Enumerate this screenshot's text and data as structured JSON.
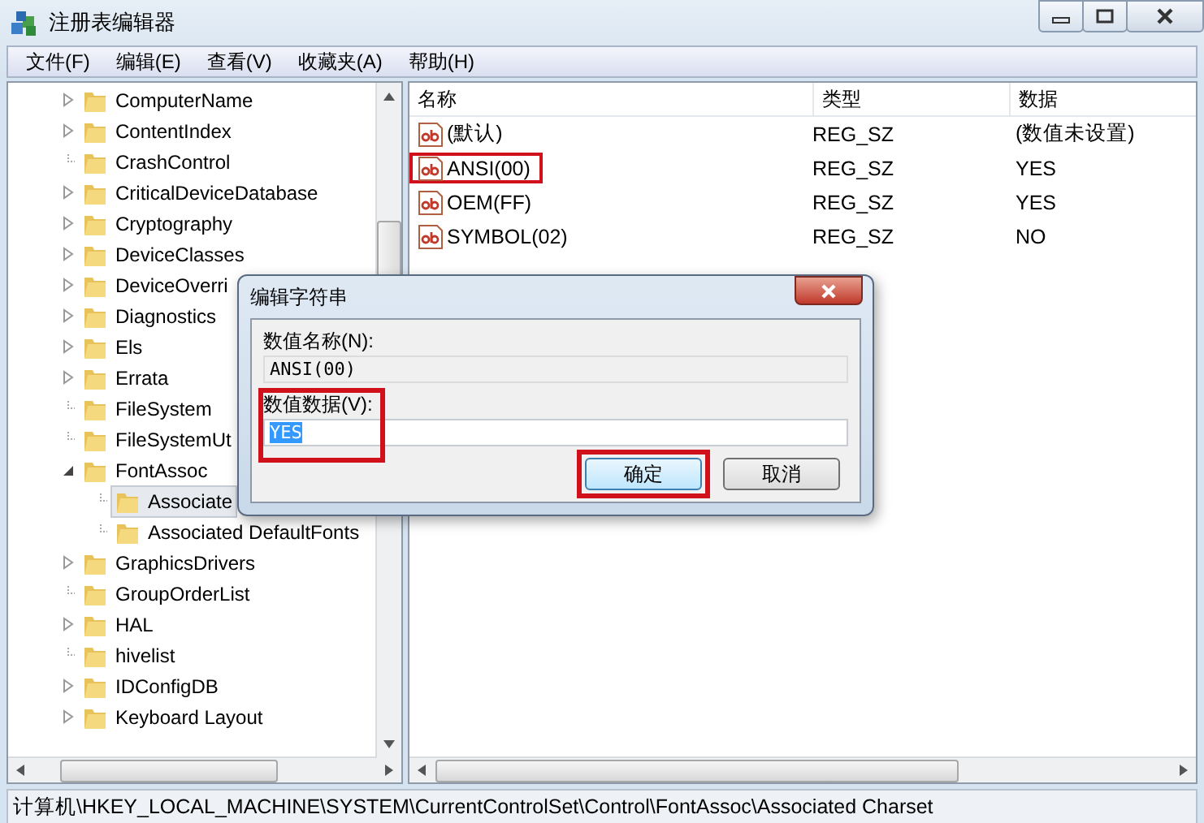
{
  "window": {
    "title": "注册表编辑器"
  },
  "menu": [
    "文件(F)",
    "编辑(E)",
    "查看(V)",
    "收藏夹(A)",
    "帮助(H)"
  ],
  "tree": {
    "items": [
      {
        "label": "ComputerName",
        "kind": "collapsed",
        "selected": false
      },
      {
        "label": "ContentIndex",
        "kind": "collapsed",
        "selected": false
      },
      {
        "label": "CrashControl",
        "kind": "leaf",
        "selected": false
      },
      {
        "label": "CriticalDeviceDatabase",
        "kind": "collapsed",
        "selected": false
      },
      {
        "label": "Cryptography",
        "kind": "collapsed",
        "selected": false
      },
      {
        "label": "DeviceClasses",
        "kind": "collapsed",
        "selected": false
      },
      {
        "label": "DeviceOverri",
        "kind": "collapsed",
        "selected": false
      },
      {
        "label": "Diagnostics",
        "kind": "collapsed",
        "selected": false
      },
      {
        "label": "Els",
        "kind": "collapsed",
        "selected": false
      },
      {
        "label": "Errata",
        "kind": "collapsed",
        "selected": false
      },
      {
        "label": "FileSystem",
        "kind": "leaf",
        "selected": false
      },
      {
        "label": "FileSystemUt",
        "kind": "leaf",
        "selected": false
      },
      {
        "label": "FontAssoc",
        "kind": "expanded",
        "selected": false,
        "children": [
          {
            "label": "Associate",
            "kind": "leaf",
            "selected": true
          },
          {
            "label": "Associated DefaultFonts",
            "kind": "leaf",
            "selected": false
          }
        ]
      },
      {
        "label": "GraphicsDrivers",
        "kind": "collapsed",
        "selected": false
      },
      {
        "label": "GroupOrderList",
        "kind": "leaf",
        "selected": false
      },
      {
        "label": "HAL",
        "kind": "collapsed",
        "selected": false
      },
      {
        "label": "hivelist",
        "kind": "leaf",
        "selected": false
      },
      {
        "label": "IDConfigDB",
        "kind": "collapsed",
        "selected": false
      },
      {
        "label": "Keyboard Layout",
        "kind": "collapsed",
        "selected": false
      }
    ]
  },
  "values": {
    "columns": [
      "名称",
      "类型",
      "数据"
    ],
    "rows": [
      {
        "name": "(默认)",
        "type": "REG_SZ",
        "data": "(数值未设置)",
        "marked": false
      },
      {
        "name": "ANSI(00)",
        "type": "REG_SZ",
        "data": "YES",
        "marked": true
      },
      {
        "name": "OEM(FF)",
        "type": "REG_SZ",
        "data": "YES",
        "marked": false
      },
      {
        "name": "SYMBOL(02)",
        "type": "REG_SZ",
        "data": "NO",
        "marked": false
      }
    ]
  },
  "dialog": {
    "title": "编辑字符串",
    "name_label": "数值名称(N):",
    "name_value": "ANSI(00)",
    "data_label": "数值数据(V):",
    "data_label_marked": true,
    "data_value": "YES",
    "data_value_selected": true,
    "buttons": [
      {
        "label": "确定",
        "default": true,
        "marked": true
      },
      {
        "label": "取消",
        "default": false,
        "marked": false
      }
    ]
  },
  "status_bar": "计算机\\HKEY_LOCAL_MACHINE\\SYSTEM\\CurrentControlSet\\Control\\FontAssoc\\Associated Charset"
}
